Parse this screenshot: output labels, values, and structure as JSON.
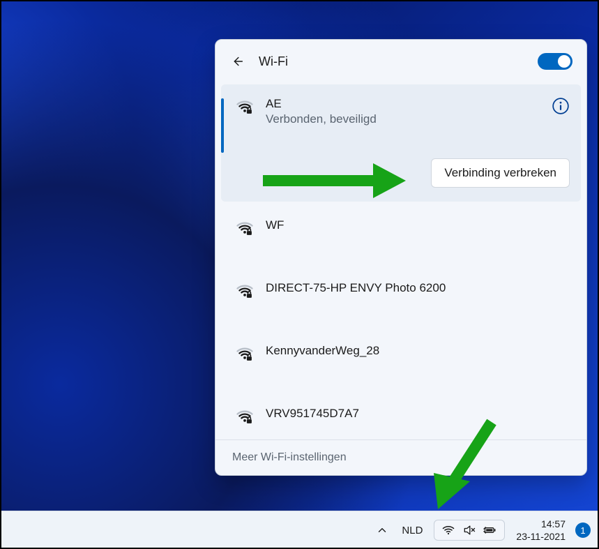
{
  "header": {
    "title": "Wi-Fi",
    "toggle_on": true
  },
  "networks": [
    {
      "name": "AE",
      "status": "Verbonden, beveiligd",
      "selected": true,
      "secured": true
    },
    {
      "name": "WF",
      "secured": true
    },
    {
      "name": "DIRECT-75-HP ENVY Photo 6200",
      "secured": true
    },
    {
      "name": "KennyvanderWeg_28",
      "secured": true
    },
    {
      "name": "VRV951745D7A7",
      "secured": true
    }
  ],
  "buttons": {
    "disconnect": "Verbinding verbreken"
  },
  "footer": {
    "more_settings": "Meer Wi-Fi-instellingen"
  },
  "taskbar": {
    "language": "NLD",
    "time": "14:57",
    "date": "23-11-2021",
    "notification_count": "1"
  }
}
